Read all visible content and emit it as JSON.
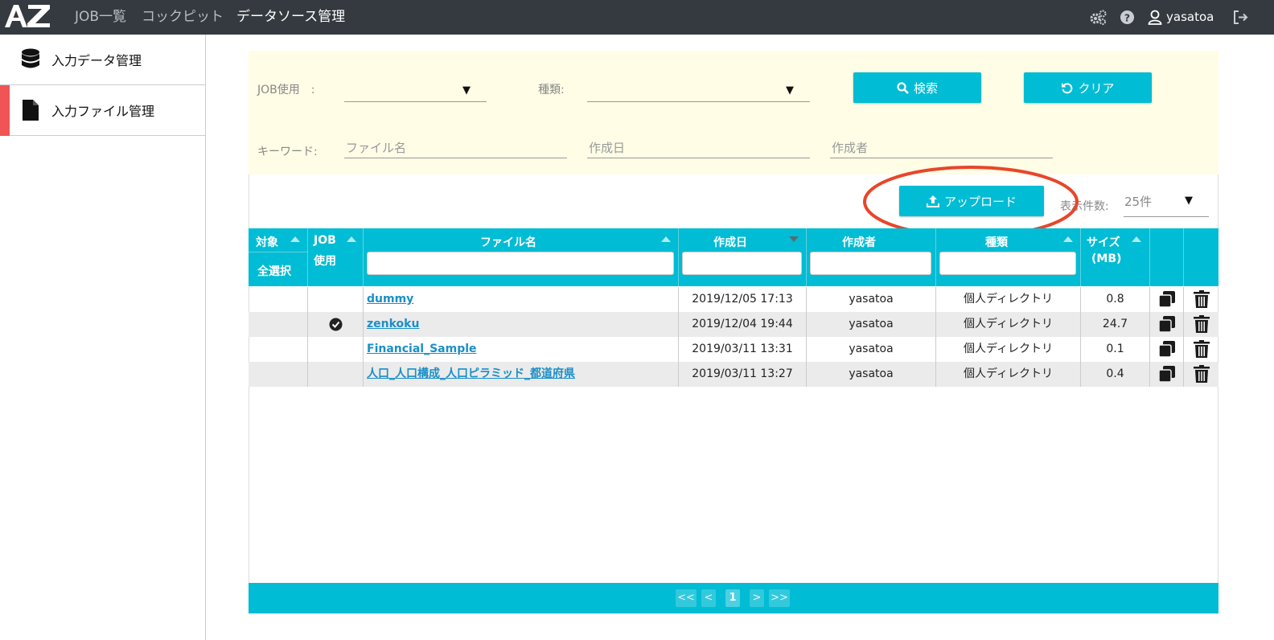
{
  "topbar": {
    "logo": "AZ",
    "nav": [
      "JOB一覧",
      "コックピット",
      "データソース管理"
    ],
    "active_nav": 2,
    "username": "yasatoa"
  },
  "sidebar": {
    "items": [
      {
        "label": "入力データ管理",
        "icon": "database-icon"
      },
      {
        "label": "入力ファイル管理",
        "icon": "file-icon"
      }
    ]
  },
  "filter": {
    "job_label": "JOB使用　:",
    "type_label": "種類:",
    "keyword_label": "キーワード:",
    "filename_placeholder": "ファイル名",
    "date_placeholder": "作成日",
    "author_placeholder": "作成者",
    "search_button": "検索",
    "clear_button": "クリア"
  },
  "toolbar": {
    "upload_button": "アップロード",
    "perpage_label": "表示件数:",
    "perpage_value": "25件"
  },
  "table": {
    "headers": {
      "target": "対象",
      "select_all": "全選択",
      "job_line1": "JOB",
      "job_line2": "使用",
      "filename": "ファイル名",
      "date": "作成日",
      "author": "作成者",
      "type": "種類",
      "size_line1": "サイズ",
      "size_line2": "(MB)"
    },
    "rows": [
      {
        "name": "dummy",
        "job_used": false,
        "date": "2019/12/05 17:13",
        "author": "yasatoa",
        "type": "個人ディレクトリ",
        "size": "0.8"
      },
      {
        "name": "zenkoku",
        "job_used": true,
        "date": "2019/12/04 19:44",
        "author": "yasatoa",
        "type": "個人ディレクトリ",
        "size": "24.7"
      },
      {
        "name": "Financial_Sample",
        "job_used": false,
        "date": "2019/03/11 13:31",
        "author": "yasatoa",
        "type": "個人ディレクトリ",
        "size": "0.1"
      },
      {
        "name": "人口_人口構成_人口ピラミッド_都道府県",
        "job_used": false,
        "date": "2019/03/11 13:27",
        "author": "yasatoa",
        "type": "個人ディレクトリ",
        "size": "0.4"
      }
    ]
  },
  "pager": {
    "first": "<<",
    "prev": "<",
    "current": "1",
    "next": ">",
    "last": ">>"
  },
  "colors": {
    "accent": "#00bcd4",
    "topbar": "#343a40",
    "sidebar_active": "#f05454",
    "filter_bg": "#fffde6",
    "annotation": "#e8462a"
  }
}
